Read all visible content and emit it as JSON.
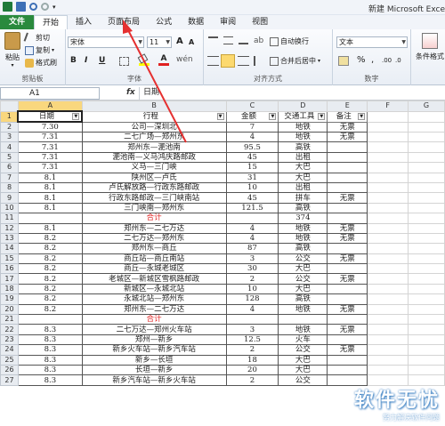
{
  "window": {
    "title": "新建 Microsoft Exce"
  },
  "tabs": [
    "文件",
    "开始",
    "插入",
    "页面布局",
    "公式",
    "数据",
    "审阅",
    "视图"
  ],
  "ribbon": {
    "clipboard": {
      "paste": "粘贴",
      "cut": "剪切",
      "copy": "复制",
      "format_painter": "格式刷",
      "label": "剪贴板"
    },
    "font": {
      "name": "宋体",
      "size": "11",
      "label": "字体",
      "bold": "B",
      "italic": "I",
      "underline": "U",
      "grow": "A",
      "shrink": "A",
      "color": "A"
    },
    "alignment": {
      "wrap": "自动换行",
      "merge": "合并后居中",
      "label": "对齐方式"
    },
    "number": {
      "format": "文本",
      "label": "数字"
    },
    "styles": {
      "conditional": "条件格式"
    }
  },
  "formula_bar": {
    "cell": "A1",
    "fx": "fx",
    "value": "日期"
  },
  "columns": [
    "A",
    "B",
    "C",
    "D",
    "E",
    "F",
    "G"
  ],
  "header": [
    "日期",
    "行程",
    "金额",
    "交通工具",
    "备注"
  ],
  "rows": [
    {
      "n": "2",
      "a": "7.30",
      "b": "公司—深圳北",
      "c": "7",
      "d": "地铁",
      "e": "无票"
    },
    {
      "n": "3",
      "a": "7.31",
      "b": "二七广场—郑州东",
      "c": "4",
      "d": "地铁",
      "e": "无票"
    },
    {
      "n": "4",
      "a": "7.31",
      "b": "郑州东—淝池南",
      "c": "95.5",
      "d": "高铁",
      "e": ""
    },
    {
      "n": "5",
      "a": "7.31",
      "b": "淝池南—义马鸿庆路邮政",
      "c": "45",
      "d": "出租",
      "e": ""
    },
    {
      "n": "6",
      "a": "7.31",
      "b": "义马—三门峡",
      "c": "15",
      "d": "大巴",
      "e": ""
    },
    {
      "n": "7",
      "a": "8.1",
      "b": "陕州区—卢氏",
      "c": "31",
      "d": "大巴",
      "e": ""
    },
    {
      "n": "8",
      "a": "8.1",
      "b": "卢氏解放路—行政东路邮政",
      "c": "10",
      "d": "出租",
      "e": ""
    },
    {
      "n": "9",
      "a": "8.1",
      "b": "行政东路邮政—三门峡南站",
      "c": "45",
      "d": "拼车",
      "e": "无票"
    },
    {
      "n": "10",
      "a": "8.1",
      "b": "三门峡南—郑州东",
      "c": "121.5",
      "d": "高铁",
      "e": ""
    },
    {
      "n": "11",
      "a": "",
      "b": "合计",
      "c": "",
      "d": "374",
      "e": "",
      "total": true
    },
    {
      "n": "12",
      "a": "8.1",
      "b": "郑州东—二七万达",
      "c": "4",
      "d": "地铁",
      "e": "无票"
    },
    {
      "n": "13",
      "a": "8.2",
      "b": "二七万达—郑州东",
      "c": "4",
      "d": "地铁",
      "e": "无票"
    },
    {
      "n": "14",
      "a": "8.2",
      "b": "郑州东—商丘",
      "c": "87",
      "d": "高铁",
      "e": ""
    },
    {
      "n": "15",
      "a": "8.2",
      "b": "商丘站—商丘南站",
      "c": "3",
      "d": "公交",
      "e": "无票"
    },
    {
      "n": "16",
      "a": "8.2",
      "b": "商丘—永城老城区",
      "c": "30",
      "d": "大巴",
      "e": ""
    },
    {
      "n": "17",
      "a": "8.2",
      "b": "老城区—新城区雪枫路邮政",
      "c": "2",
      "d": "公交",
      "e": "无票"
    },
    {
      "n": "18",
      "a": "8.2",
      "b": "新城区—永城北站",
      "c": "10",
      "d": "大巴",
      "e": ""
    },
    {
      "n": "19",
      "a": "8.2",
      "b": "永城北站—郑州东",
      "c": "128",
      "d": "高铁",
      "e": ""
    },
    {
      "n": "20",
      "a": "8.2",
      "b": "郑州东—二七万达",
      "c": "4",
      "d": "地铁",
      "e": "无票"
    },
    {
      "n": "21",
      "a": "",
      "b": "合计",
      "c": "",
      "d": "",
      "e": "",
      "total": true
    },
    {
      "n": "22",
      "a": "8.3",
      "b": "二七万达—郑州火车站",
      "c": "3",
      "d": "地铁",
      "e": "无票"
    },
    {
      "n": "23",
      "a": "8.3",
      "b": "郑州—新乡",
      "c": "12.5",
      "d": "火车",
      "e": ""
    },
    {
      "n": "24",
      "a": "8.3",
      "b": "新乡火车站—新乡汽车站",
      "c": "2",
      "d": "公交",
      "e": "无票"
    },
    {
      "n": "25",
      "a": "8.3",
      "b": "新乡—长垣",
      "c": "18",
      "d": "大巴",
      "e": ""
    },
    {
      "n": "26",
      "a": "8.3",
      "b": "长垣—新乡",
      "c": "20",
      "d": "大巴",
      "e": ""
    },
    {
      "n": "27",
      "a": "8.3",
      "b": "新乡汽车站—新乡火车站",
      "c": "2",
      "d": "公交",
      "e": ""
    }
  ],
  "watermark": {
    "main": "软件无忧",
    "sub": "努力解决软件问题"
  },
  "colors": {
    "file_tab": "#2a8a3d",
    "selection": "#f9d77e",
    "total_text": "#e02020",
    "arrow": "#e53030"
  }
}
